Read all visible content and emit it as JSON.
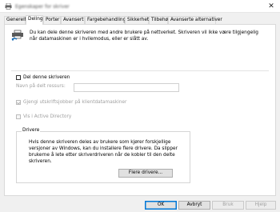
{
  "window": {
    "title": "Egenskaper for skriver",
    "close_label": "✕"
  },
  "tabs": [
    {
      "label": "Generelt"
    },
    {
      "label": "Deling"
    },
    {
      "label": "Porter"
    },
    {
      "label": "Avansert"
    },
    {
      "label": "Fargebehandling"
    },
    {
      "label": "Sikkerhet"
    },
    {
      "label": "Tilbehør"
    },
    {
      "label": "Avanserte alternativer"
    }
  ],
  "sharing": {
    "intro": "Du kan dele denne skriveren med andre brukere på nettverket. Skriveren vil ikke være tilgjengelig når datamaskinen er i hvilemodus, eller er slått av.",
    "share_checkbox": {
      "label": "Del denne skriveren",
      "checked": false
    },
    "share_name": {
      "label": "Navn på delt ressurs:",
      "value": ""
    },
    "render_jobs": {
      "label": "Gjengi utskriftsjobber på klientdatamaskiner",
      "checked": true
    },
    "list_in_directory": {
      "label": "Vis i Active Directory",
      "checked": false
    },
    "drivers": {
      "title": "Drivere",
      "text": "Hvis denne skriveren deles av brukere som kjører forskjellige versjoner av Windows, kan du installere flere drivere. Da slipper brukerne å lete etter skriverdriveren når de kobler til den delte skriveren.",
      "button": "Flere drivere..."
    }
  },
  "footer": {
    "ok": "OK",
    "cancel": "Avbryt",
    "apply": "Bruk",
    "help": "Hjelp"
  },
  "colors": {
    "accent": "#0078d7",
    "dialog_bg": "#f0f0f0",
    "panel_bg": "#ffffff"
  },
  "icons": {
    "title": "printer-icon",
    "intro": "shared-printer-icon"
  }
}
